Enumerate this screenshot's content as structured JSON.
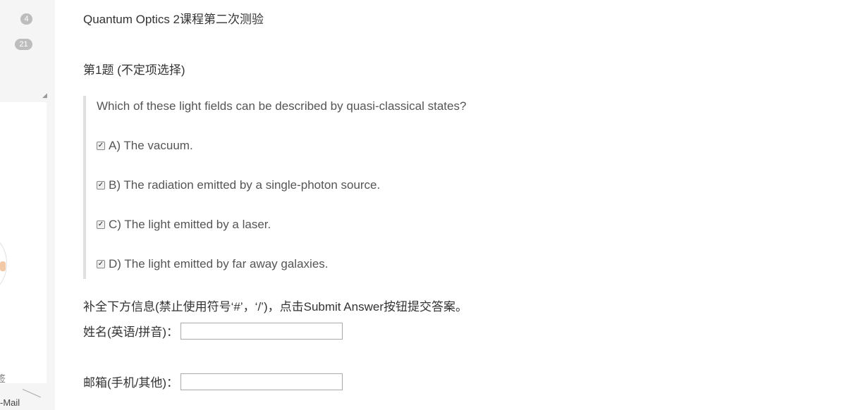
{
  "sidebar": {
    "badges": [
      "4",
      "21"
    ],
    "labels": [
      "签",
      "-Mail"
    ]
  },
  "page_title": "Quantum Optics 2课程第二次测验",
  "question": {
    "title": "第1题 (不定项选择)",
    "text": "Which of these light fields can be described by quasi-classical states?",
    "options": [
      {
        "label": "A) The vacuum.",
        "checked": true
      },
      {
        "label": "B) The radiation emitted by a single-photon source.",
        "checked": true
      },
      {
        "label": "C) The light emitted by a laser.",
        "checked": true
      },
      {
        "label": "D) The light emitted by far away galaxies.",
        "checked": true
      }
    ]
  },
  "form": {
    "instruction": "补全下方信息(禁止使用符号‘#’，‘/’)，点击Submit Answer按钮提交答案。",
    "name_label": "姓名(英语/拼音)：",
    "name_value": "",
    "contact_label": "邮箱(手机/其他)：",
    "contact_value": ""
  },
  "icons": {
    "checkbox": "checkmark-icon"
  }
}
